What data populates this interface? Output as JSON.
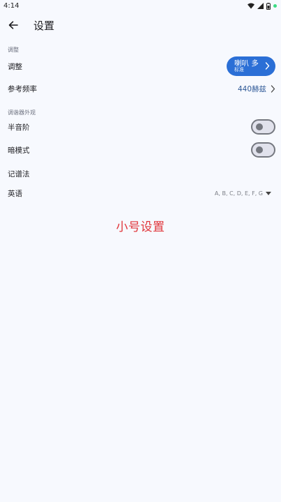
{
  "status": {
    "time": "4:14"
  },
  "header": {
    "title": "设置"
  },
  "sections": {
    "tuning": {
      "header": "调整",
      "adjust": {
        "label": "调整",
        "button_main": "喇叭 多",
        "button_sub": "标准"
      },
      "reference": {
        "label": "参考频率",
        "value": "440赫兹"
      }
    },
    "appearance": {
      "header": "调谐器外观",
      "semitone": {
        "label": "半音阶",
        "enabled": false
      },
      "dark_mode": {
        "label": "暗模式",
        "enabled": false
      },
      "notation": {
        "label": "记谱法"
      },
      "notation_option": {
        "label": "英语",
        "value": "A, B, C, D, E, F, G"
      }
    }
  },
  "caption": "小号设置",
  "colors": {
    "accent": "#2b6fd6",
    "link": "#2c5796",
    "caption": "#e0353a",
    "background": "#f7f9fe"
  }
}
